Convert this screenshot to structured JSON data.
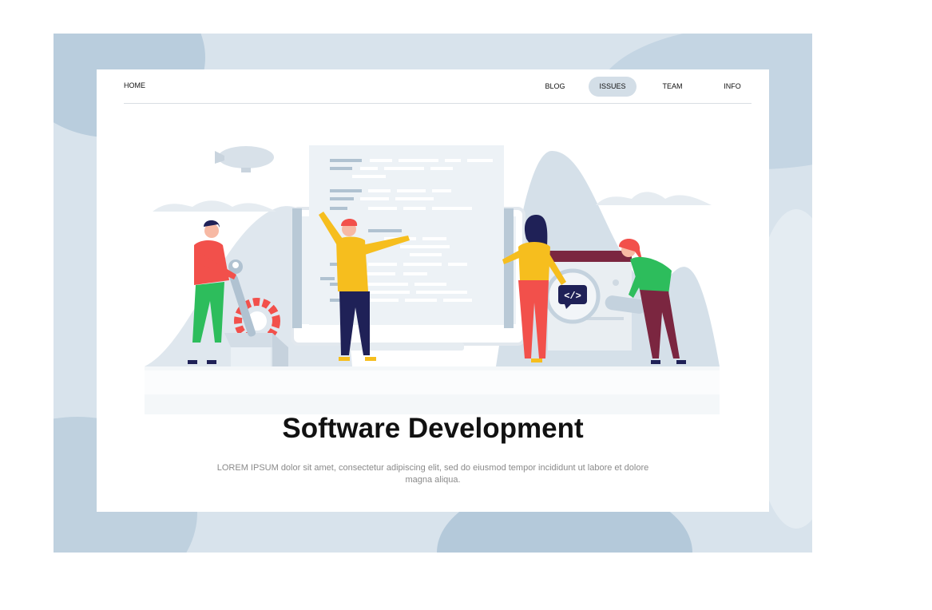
{
  "nav": {
    "home": "HOME",
    "items": [
      {
        "label": "BLOG",
        "active": false
      },
      {
        "label": "ISSUES",
        "active": true
      },
      {
        "label": "TEAM",
        "active": false
      },
      {
        "label": "INFO",
        "active": false
      }
    ]
  },
  "hero": {
    "title": "Software Development",
    "text": "LOREM IPSUM dolor sit amet, consectetur adipiscing elit, sed do eiusmod tempor incididunt ut labore et dolore magna aliqua."
  },
  "illustration": {
    "code_badge": "</>"
  },
  "colors": {
    "backdrop": "#d8e3ec",
    "backdrop_blob": "#b4c9da",
    "nav_active_bg": "#d3dee7",
    "red": "#f2504b",
    "yellow": "#f6be1e",
    "green": "#2dbd5c",
    "navy": "#1f2157",
    "maroon": "#7b2640"
  }
}
